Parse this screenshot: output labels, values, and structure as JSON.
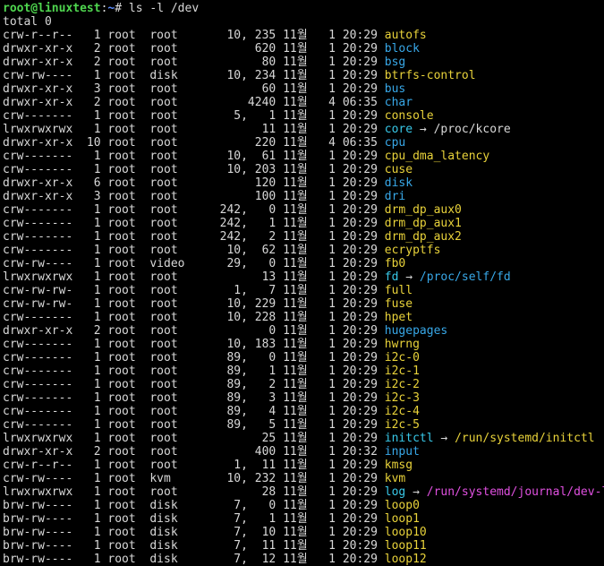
{
  "prompt": {
    "user_host": "root@linuxtest",
    "separator": ":",
    "path": "~",
    "symbol": "#",
    "command": " ls -l /dev"
  },
  "total_line": "total 0",
  "colors": {
    "directory": "#38a8e8",
    "device": "#e8d23a",
    "symlink": "#38c8e8",
    "link_target_dir": "#38a8e8",
    "link_target_dev": "#e8d23a",
    "link_target_socket": "#e050e0",
    "prompt_user": "#4fd64f",
    "prompt_path": "#5b8cff"
  },
  "entries": [
    {
      "meta": "crw-r--r--   1 root  root       10, 235 11월   1 20:29 ",
      "name": "autofs",
      "kind": "device"
    },
    {
      "meta": "drwxr-xr-x   2 root  root           620 11월   1 20:29 ",
      "name": "block",
      "kind": "directory"
    },
    {
      "meta": "drwxr-xr-x   2 root  root            80 11월   1 20:29 ",
      "name": "bsg",
      "kind": "directory"
    },
    {
      "meta": "crw-rw----   1 root  disk       10, 234 11월   1 20:29 ",
      "name": "btrfs-control",
      "kind": "device"
    },
    {
      "meta": "drwxr-xr-x   3 root  root            60 11월   1 20:29 ",
      "name": "bus",
      "kind": "directory"
    },
    {
      "meta": "drwxr-xr-x   2 root  root          4240 11월   4 06:35 ",
      "name": "char",
      "kind": "directory"
    },
    {
      "meta": "crw-------   1 root  root        5,   1 11월   1 20:29 ",
      "name": "console",
      "kind": "device"
    },
    {
      "meta": "lrwxrwxrwx   1 root  root            11 11월   1 20:29 ",
      "name": "core",
      "kind": "symlink",
      "arrow": " → ",
      "target": "/proc/kcore",
      "target_kind": "plain"
    },
    {
      "meta": "drwxr-xr-x  10 root  root           220 11월   4 06:35 ",
      "name": "cpu",
      "kind": "directory"
    },
    {
      "meta": "crw-------   1 root  root       10,  61 11월   1 20:29 ",
      "name": "cpu_dma_latency",
      "kind": "device"
    },
    {
      "meta": "crw-------   1 root  root       10, 203 11월   1 20:29 ",
      "name": "cuse",
      "kind": "device"
    },
    {
      "meta": "drwxr-xr-x   6 root  root           120 11월   1 20:29 ",
      "name": "disk",
      "kind": "directory"
    },
    {
      "meta": "drwxr-xr-x   3 root  root           100 11월   1 20:29 ",
      "name": "dri",
      "kind": "directory"
    },
    {
      "meta": "crw-------   1 root  root      242,   0 11월   1 20:29 ",
      "name": "drm_dp_aux0",
      "kind": "device"
    },
    {
      "meta": "crw-------   1 root  root      242,   1 11월   1 20:29 ",
      "name": "drm_dp_aux1",
      "kind": "device"
    },
    {
      "meta": "crw-------   1 root  root      242,   2 11월   1 20:29 ",
      "name": "drm_dp_aux2",
      "kind": "device"
    },
    {
      "meta": "crw-------   1 root  root       10,  62 11월   1 20:29 ",
      "name": "ecryptfs",
      "kind": "device"
    },
    {
      "meta": "crw-rw----   1 root  video      29,   0 11월   1 20:29 ",
      "name": "fb0",
      "kind": "device"
    },
    {
      "meta": "lrwxrwxrwx   1 root  root            13 11월   1 20:29 ",
      "name": "fd",
      "kind": "symlink",
      "arrow": " → ",
      "target": "/proc/self/fd",
      "target_kind": "directory"
    },
    {
      "meta": "crw-rw-rw-   1 root  root        1,   7 11월   1 20:29 ",
      "name": "full",
      "kind": "device"
    },
    {
      "meta": "crw-rw-rw-   1 root  root       10, 229 11월   1 20:29 ",
      "name": "fuse",
      "kind": "device"
    },
    {
      "meta": "crw-------   1 root  root       10, 228 11월   1 20:29 ",
      "name": "hpet",
      "kind": "device"
    },
    {
      "meta": "drwxr-xr-x   2 root  root             0 11월   1 20:29 ",
      "name": "hugepages",
      "kind": "directory"
    },
    {
      "meta": "crw-------   1 root  root       10, 183 11월   1 20:29 ",
      "name": "hwrng",
      "kind": "device"
    },
    {
      "meta": "crw-------   1 root  root       89,   0 11월   1 20:29 ",
      "name": "i2c-0",
      "kind": "device"
    },
    {
      "meta": "crw-------   1 root  root       89,   1 11월   1 20:29 ",
      "name": "i2c-1",
      "kind": "device"
    },
    {
      "meta": "crw-------   1 root  root       89,   2 11월   1 20:29 ",
      "name": "i2c-2",
      "kind": "device"
    },
    {
      "meta": "crw-------   1 root  root       89,   3 11월   1 20:29 ",
      "name": "i2c-3",
      "kind": "device"
    },
    {
      "meta": "crw-------   1 root  root       89,   4 11월   1 20:29 ",
      "name": "i2c-4",
      "kind": "device"
    },
    {
      "meta": "crw-------   1 root  root       89,   5 11월   1 20:29 ",
      "name": "i2c-5",
      "kind": "device"
    },
    {
      "meta": "lrwxrwxrwx   1 root  root            25 11월   1 20:29 ",
      "name": "initctl",
      "kind": "symlink",
      "arrow": " → ",
      "target": "/run/systemd/initctl",
      "target_kind": "device"
    },
    {
      "meta": "drwxr-xr-x   2 root  root           400 11월   1 20:32 ",
      "name": "input",
      "kind": "directory"
    },
    {
      "meta": "crw-r--r--   1 root  root        1,  11 11월   1 20:29 ",
      "name": "kmsg",
      "kind": "device"
    },
    {
      "meta": "crw-rw----   1 root  kvm        10, 232 11월   1 20:29 ",
      "name": "kvm",
      "kind": "device"
    },
    {
      "meta": "lrwxrwxrwx   1 root  root            28 11월   1 20:29 ",
      "name": "log",
      "kind": "symlink",
      "arrow": " → ",
      "target": "/run/systemd/journal/dev-log",
      "target_kind": "socket"
    },
    {
      "meta": "brw-rw----   1 root  disk        7,   0 11월   1 20:29 ",
      "name": "loop0",
      "kind": "device"
    },
    {
      "meta": "brw-rw----   1 root  disk        7,   1 11월   1 20:29 ",
      "name": "loop1",
      "kind": "device"
    },
    {
      "meta": "brw-rw----   1 root  disk        7,  10 11월   1 20:29 ",
      "name": "loop10",
      "kind": "device"
    },
    {
      "meta": "brw-rw----   1 root  disk        7,  11 11월   1 20:29 ",
      "name": "loop11",
      "kind": "device"
    },
    {
      "meta": "brw-rw----   1 root  disk        7,  12 11월   1 20:29 ",
      "name": "loop12",
      "kind": "device"
    }
  ]
}
